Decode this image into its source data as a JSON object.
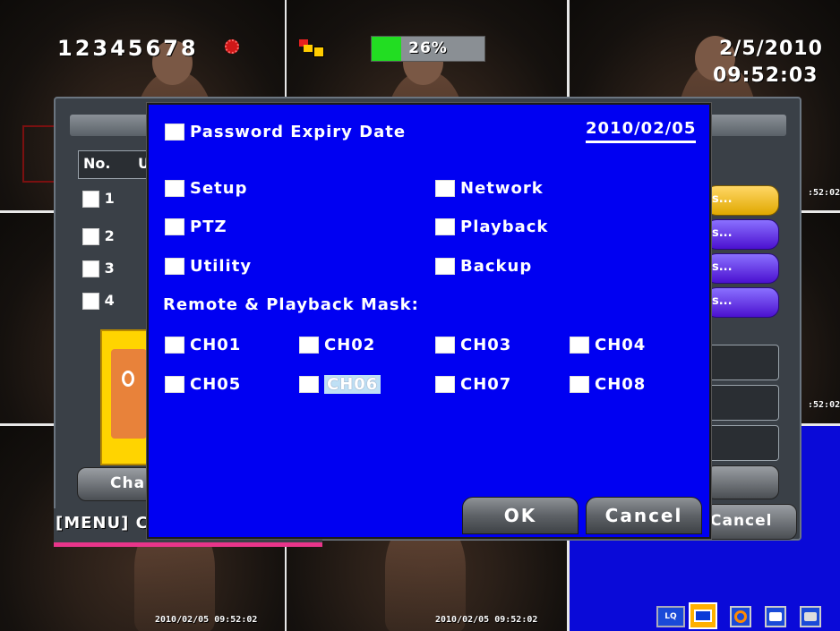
{
  "overlay": {
    "channels_text": "12345678",
    "progress_percent": "26%",
    "progress_value": 0.26,
    "date": "2/5/2010",
    "time": "09:52:03",
    "cam_timestamp_1": "2010/02/05 09:52:02",
    "cam_timestamp_2": "2010/02/05 09:52:02",
    "side_time_1": ":52:02",
    "side_time_2": ":52:02"
  },
  "background_dialog": {
    "col_no": "No.",
    "col_u": "U",
    "rows": [
      "1",
      "2",
      "3",
      "4"
    ],
    "change_btn": "Cha",
    "cancel_btn": "Cancel",
    "pill_text": "s...",
    "menu_hint": "[MENU] C"
  },
  "dialog": {
    "password_expiry_label": "Password Expiry Date",
    "password_expiry_value": "2010/02/05",
    "permissions": {
      "setup": "Setup",
      "network": "Network",
      "ptz": "PTZ",
      "playback": "Playback",
      "utility": "Utility",
      "backup": "Backup"
    },
    "mask_title": "Remote & Playback Mask:",
    "channels": [
      "CH01",
      "CH02",
      "CH03",
      "CH04",
      "CH05",
      "CH06",
      "CH07",
      "CH08"
    ],
    "selected_channel": "CH06",
    "ok_label": "OK",
    "cancel_label": "Cancel"
  },
  "taskbar": {
    "lq_label": "LQ"
  },
  "colors": {
    "dialog_bg": "#0000f2",
    "progress_fill": "#22dd22",
    "accent_pink": "#e8358a",
    "pill_yellow": "#e0a800",
    "pill_purple": "#5a1fd8"
  }
}
